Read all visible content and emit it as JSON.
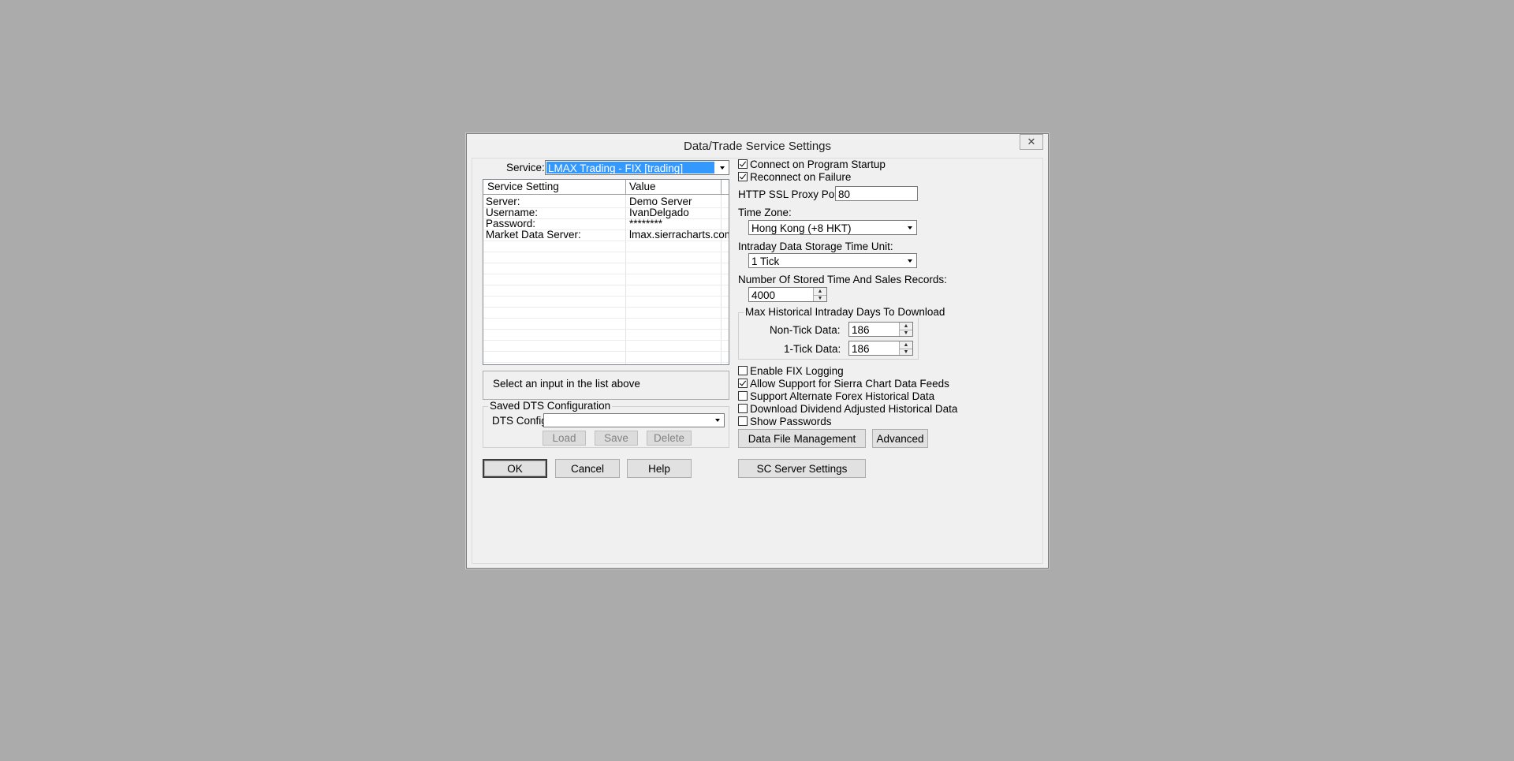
{
  "window": {
    "title": "Data/Trade Service Settings",
    "close_glyph": "✕"
  },
  "service": {
    "label": "Service:",
    "value": "LMAX Trading - FIX    [trading]"
  },
  "grid": {
    "headers": [
      "Service Setting",
      "Value"
    ],
    "rows": [
      {
        "setting": "Server:",
        "value": "Demo Server"
      },
      {
        "setting": "Username:",
        "value": "IvanDelgado"
      },
      {
        "setting": "Password:",
        "value": "********"
      },
      {
        "setting": "Market Data Server:",
        "value": "lmax.sierracharts.com"
      }
    ]
  },
  "description": "Select an input in the list above",
  "saved_dts": {
    "group_title": "Saved DTS Configuration",
    "config_label": "DTS Config:",
    "config_value": "",
    "load": "Load",
    "save": "Save",
    "delete": "Delete"
  },
  "buttons": {
    "ok": "OK",
    "cancel": "Cancel",
    "help": "Help",
    "data_file_management": "Data File Management",
    "advanced": "Advanced",
    "sc_server_settings": "SC Server Settings"
  },
  "options": {
    "connect_on_startup": {
      "label": "Connect on Program Startup",
      "checked": true
    },
    "reconnect_on_failure": {
      "label": "Reconnect on Failure",
      "checked": true
    },
    "enable_fix_logging": {
      "label": "Enable FIX Logging",
      "checked": false
    },
    "allow_sc_data_feeds": {
      "label": "Allow Support for Sierra Chart Data Feeds",
      "checked": true
    },
    "alternate_forex": {
      "label": "Support Alternate Forex Historical Data",
      "checked": false
    },
    "dividend_adjusted": {
      "label": "Download Dividend Adjusted Historical Data",
      "checked": false
    },
    "show_passwords": {
      "label": "Show Passwords",
      "checked": false
    }
  },
  "proxy": {
    "label": "HTTP SSL Proxy Port:",
    "value": "80"
  },
  "timezone": {
    "label": "Time Zone:",
    "value": "Hong Kong (+8 HKT)"
  },
  "storage_unit": {
    "label": "Intraday Data Storage Time Unit:",
    "value": "1 Tick"
  },
  "stored_records": {
    "label": "Number Of Stored Time And Sales Records:",
    "value": "4000"
  },
  "historical": {
    "group_title": "Max Historical Intraday Days To Download",
    "non_tick_label": "Non-Tick Data:",
    "non_tick_value": "186",
    "tick_label": "1-Tick Data:",
    "tick_value": "186"
  },
  "spin": {
    "up": "▲",
    "down": "▼"
  }
}
